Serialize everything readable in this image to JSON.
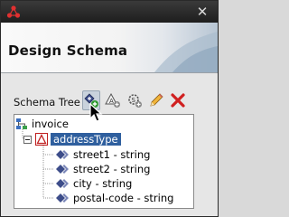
{
  "window": {
    "title": ""
  },
  "header": {
    "title": "Design Schema"
  },
  "toolbar": {
    "label": "Schema Tree",
    "buttons": [
      {
        "name": "add-element-button",
        "icon": "add-node-icon"
      },
      {
        "name": "add-attribute-button",
        "icon": "add-attribute-icon"
      },
      {
        "name": "schema-settings-button",
        "icon": "schema-settings-icon"
      },
      {
        "name": "edit-button",
        "icon": "pencil-icon"
      },
      {
        "name": "delete-button",
        "icon": "red-x-icon"
      }
    ]
  },
  "tree": {
    "root": "invoice",
    "type_node": "addressType",
    "fields": [
      "street1 - string",
      "street2 - string",
      "city - string",
      "postal-code - string"
    ]
  },
  "colors": {
    "selection": "#2f5f9e",
    "delete": "#d02020",
    "titlebar": "#262626"
  }
}
